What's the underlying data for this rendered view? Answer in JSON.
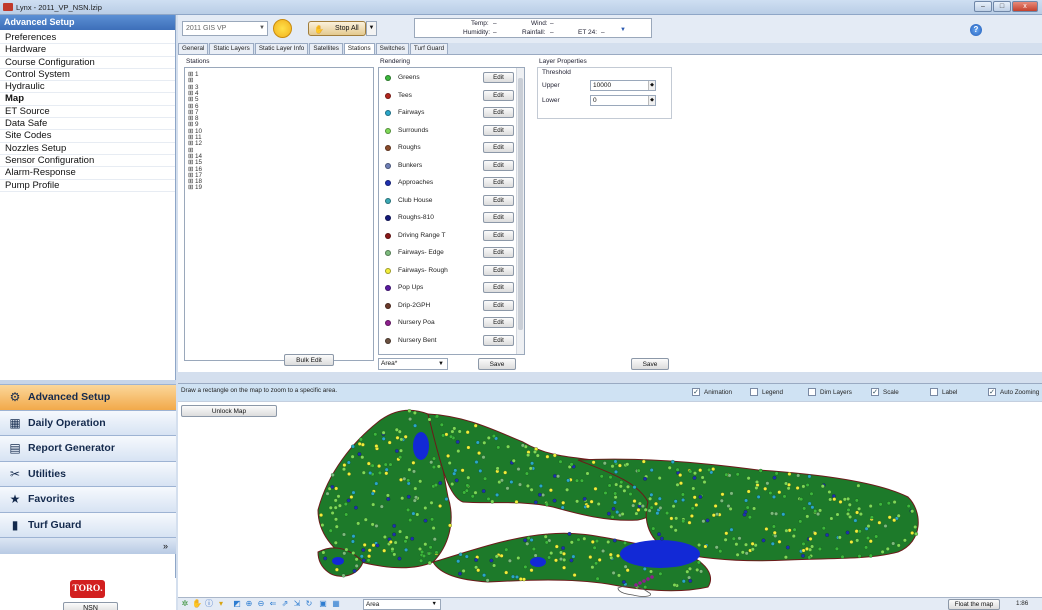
{
  "window": {
    "title": "Lynx - 2011_VP_NSN.lzip",
    "min": "–",
    "max": "□",
    "close": "x"
  },
  "nav": {
    "header": "Advanced Setup",
    "items": [
      "Preferences",
      "Hardware",
      "Course Configuration",
      "Control System",
      "Hydraulic",
      "Map",
      "ET Source",
      "Data Safe",
      "Site Codes",
      "Nozzles Setup",
      "Sensor Configuration",
      "Alarm-Response",
      "Pump Profile"
    ],
    "selected": "Map",
    "buttons": [
      {
        "label": "Advanced Setup",
        "icon": "⚙"
      },
      {
        "label": "Daily Operation",
        "icon": "▦"
      },
      {
        "label": "Report Generator",
        "icon": "▤"
      },
      {
        "label": "Utilities",
        "icon": "✂"
      },
      {
        "label": "Favorites",
        "icon": "★"
      },
      {
        "label": "Turf Guard",
        "icon": "▮"
      }
    ],
    "chevron": "»",
    "logo": "TORO.",
    "nsn_button": "NSN"
  },
  "toolbar": {
    "gis_select": "2011 GIS VP",
    "stop_all": "Stop All",
    "weather": {
      "temp_label": "Temp:",
      "temp_value": "–",
      "wind_label": "Wind:",
      "wind_value": "–",
      "humidity_label": "Humidity:",
      "humidity_value": "–",
      "rainfall_label": "Rainfall:",
      "rainfall_value": "–",
      "et24_label": "ET 24:",
      "et24_value": "–"
    }
  },
  "tabs": [
    "General",
    "Static Layers",
    "Static Layer Info",
    "Satellites",
    "Stations",
    "Switches",
    "Turf Guard"
  ],
  "active_tab": "Stations",
  "stations": {
    "label": "Stations",
    "items": [
      "1",
      "",
      "3",
      "4",
      "5",
      "6",
      "7",
      "8",
      "9",
      "10",
      "11",
      "12",
      "",
      "14",
      "15",
      "16",
      "17",
      "18",
      "19"
    ],
    "bulk_edit": "Bulk Edit"
  },
  "rendering": {
    "label": "Rendering",
    "edit_label": "Edit",
    "rows": [
      {
        "name": "Greens",
        "color": "#3cb73c"
      },
      {
        "name": "Tees",
        "color": "#b3261e"
      },
      {
        "name": "Fairways",
        "color": "#2aa7c9"
      },
      {
        "name": "Surrounds",
        "color": "#7ed957"
      },
      {
        "name": "Roughs",
        "color": "#8a4b2a"
      },
      {
        "name": "Bunkers",
        "color": "#6e7fb6"
      },
      {
        "name": "Approaches",
        "color": "#1e2fb0"
      },
      {
        "name": "Club House",
        "color": "#3aa9b5"
      },
      {
        "name": "Roughs-810",
        "color": "#151a7a"
      },
      {
        "name": "Driving Range T",
        "color": "#8a1919"
      },
      {
        "name": "Fairways- Edge",
        "color": "#7dbb7d"
      },
      {
        "name": "Fairways- Rough",
        "color": "#f2ee3a"
      },
      {
        "name": "Pop Ups",
        "color": "#5a1aa0"
      },
      {
        "name": "Drip-2GPH",
        "color": "#6b3a2a"
      },
      {
        "name": "Nursery Poa",
        "color": "#8e1f8e"
      },
      {
        "name": "Nursery Bent",
        "color": "#6b5040"
      }
    ],
    "area_select": "Area*",
    "save": "Save"
  },
  "layer_properties": {
    "label": "Layer Properties",
    "threshold_label": "Threshold",
    "upper_label": "Upper",
    "upper_value": "10000",
    "lower_label": "Lower",
    "lower_value": "0",
    "save": "Save"
  },
  "map": {
    "hint": "Draw a rectangle on the map to zoom to a specific area.",
    "unlock": "Unlock Map",
    "options": [
      {
        "label": "Animation",
        "checked": true
      },
      {
        "label": "Legend",
        "checked": false
      },
      {
        "label": "Dim Layers",
        "checked": false
      },
      {
        "label": "Scale",
        "checked": true
      },
      {
        "label": "Label",
        "checked": false
      },
      {
        "label": "Auto Zooming",
        "checked": true
      }
    ],
    "layer_colors": {
      "turf": "#1d7a2a",
      "water": "#1229d6",
      "outline": "#6b1a1a"
    }
  },
  "statusbar": {
    "area_select": "Area",
    "float": "Float the map",
    "scale": "1:86"
  }
}
